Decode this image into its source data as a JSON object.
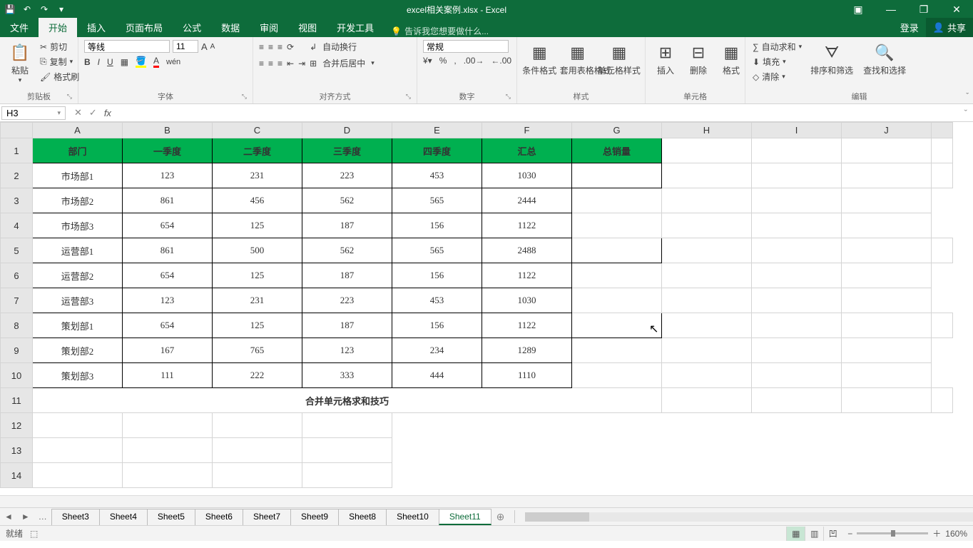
{
  "title": "excel相关案例.xlsx - Excel",
  "qat": {
    "save": "💾",
    "undo": "↶",
    "redo": "↷"
  },
  "winbtns": {
    "min": "—",
    "restore": "❐",
    "close": "✕"
  },
  "ribbon_overflow": "▣",
  "tabs": {
    "file": "文件",
    "home": "开始",
    "insert": "插入",
    "layout": "页面布局",
    "formulas": "公式",
    "data": "数据",
    "review": "审阅",
    "view": "视图",
    "dev": "开发工具",
    "tell_icon": "💡",
    "tell": "告诉我您想要做什么...",
    "login": "登录",
    "share": "共享",
    "share_icon": "👤"
  },
  "ribbon": {
    "clipboard": {
      "paste": "粘贴",
      "cut": "剪切",
      "copy": "复制",
      "format_painter": "格式刷",
      "label": "剪贴板"
    },
    "font": {
      "family": "等线",
      "size": "11",
      "bold": "B",
      "italic": "I",
      "underline": "U",
      "border": "▦",
      "fill": "🪣",
      "color": "A",
      "wen": "wén",
      "ruby": "▾",
      "increase": "A",
      "decrease": "A",
      "label": "字体"
    },
    "align": {
      "wrap": "自动换行",
      "merge": "合并后居中",
      "label": "对齐方式"
    },
    "number": {
      "format": "常规",
      "label": "数字"
    },
    "styles": {
      "cond": "条件格式",
      "table": "套用表格格式",
      "cell": "单元格样式",
      "label": "样式"
    },
    "cells": {
      "insert": "插入",
      "delete": "删除",
      "format": "格式",
      "label": "单元格"
    },
    "editing": {
      "sum": "自动求和",
      "fill": "填充",
      "clear": "清除",
      "sort": "排序和筛选",
      "find": "查找和选择",
      "label": "编辑"
    }
  },
  "namebox": "H3",
  "fx_label": "fx",
  "cols": [
    "A",
    "B",
    "C",
    "D",
    "E",
    "F",
    "G",
    "H",
    "I",
    "J"
  ],
  "headers": [
    "部门",
    "一季度",
    "二季度",
    "三季度",
    "四季度",
    "汇总",
    "总销量"
  ],
  "rows": [
    {
      "n": "2",
      "c": [
        "市场部1",
        "123",
        "231",
        "223",
        "453",
        "1030",
        ""
      ]
    },
    {
      "n": "3",
      "c": [
        "市场部2",
        "861",
        "456",
        "562",
        "565",
        "2444",
        ""
      ]
    },
    {
      "n": "4",
      "c": [
        "市场部3",
        "654",
        "125",
        "187",
        "156",
        "1122",
        ""
      ]
    },
    {
      "n": "5",
      "c": [
        "运营部1",
        "861",
        "500",
        "562",
        "565",
        "2488",
        ""
      ]
    },
    {
      "n": "6",
      "c": [
        "运营部2",
        "654",
        "125",
        "187",
        "156",
        "1122",
        ""
      ]
    },
    {
      "n": "7",
      "c": [
        "运营部3",
        "123",
        "231",
        "223",
        "453",
        "1030",
        ""
      ]
    },
    {
      "n": "8",
      "c": [
        "策划部1",
        "654",
        "125",
        "187",
        "156",
        "1122",
        ""
      ]
    },
    {
      "n": "9",
      "c": [
        "策划部2",
        "167",
        "765",
        "123",
        "234",
        "1289",
        ""
      ]
    },
    {
      "n": "10",
      "c": [
        "策划部3",
        "111",
        "222",
        "333",
        "444",
        "1110",
        ""
      ]
    }
  ],
  "merged_rows": [
    "11",
    "12",
    "13",
    "14"
  ],
  "bigtext": "合并单元格求和技巧",
  "sheets": [
    "Sheet3",
    "Sheet4",
    "Sheet5",
    "Sheet6",
    "Sheet7",
    "Sheet9",
    "Sheet8",
    "Sheet10",
    "Sheet11"
  ],
  "active_sheet": "Sheet11",
  "sheet_overflow": "…",
  "new_sheet": "⊕",
  "status": {
    "ready": "就绪",
    "macro": "⬚",
    "zoom": "160%",
    "minus": "−",
    "plus": "＋"
  },
  "collapse": "ˇ"
}
